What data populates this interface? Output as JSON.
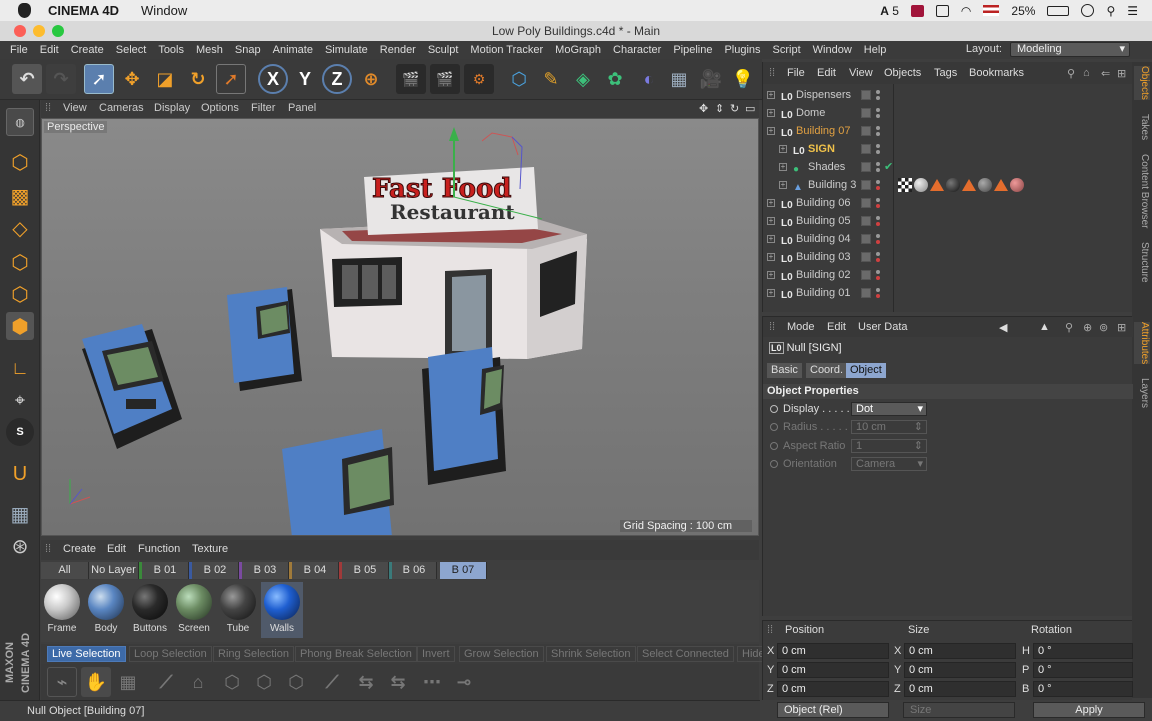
{
  "mac_menubar": {
    "app_name": "CINEMA 4D",
    "menu": "Window",
    "status": {
      "input_number": "5",
      "battery": "25%"
    }
  },
  "window": {
    "title": "Low Poly Buildings.c4d * - Main"
  },
  "main_menu": [
    "File",
    "Edit",
    "Create",
    "Select",
    "Tools",
    "Mesh",
    "Snap",
    "Animate",
    "Simulate",
    "Render",
    "Sculpt",
    "Motion Tracker",
    "MoGraph",
    "Character",
    "Pipeline",
    "Plugins",
    "Script",
    "Window",
    "Help"
  ],
  "layout": {
    "label": "Layout:",
    "value": "Modeling"
  },
  "toolbar": {
    "axis_x": "X",
    "axis_y": "Y",
    "axis_z": "Z"
  },
  "viewport": {
    "menu": [
      "View",
      "Cameras",
      "Display",
      "Options",
      "Filter",
      "Panel"
    ],
    "camera_label": "Perspective",
    "grid_spacing": "Grid Spacing : 100 cm",
    "sign_line1": "Fast Food",
    "sign_line2": "Restaurant"
  },
  "material_manager": {
    "menu": [
      "Create",
      "Edit",
      "Function",
      "Texture"
    ],
    "layers": [
      "All",
      "No Layer",
      "B 01",
      "B 02",
      "B 03",
      "B 04",
      "B 05",
      "B 06",
      "B 07"
    ],
    "active_layer": "B 07",
    "materials": [
      {
        "name": "Frame",
        "color": "#c9c9c9"
      },
      {
        "name": "Body",
        "color": "#5a86c2"
      },
      {
        "name": "Buttons",
        "color": "#2a2a2a"
      },
      {
        "name": "Screen",
        "color": "#6c8c63"
      },
      {
        "name": "Tube",
        "color": "#444444"
      },
      {
        "name": "Walls",
        "color": "#1f5fd1"
      }
    ]
  },
  "selection_bar": [
    "Live Selection",
    "Loop Selection",
    "Ring Selection",
    "Phong Break Selection",
    "Invert",
    "Grow Selection",
    "Shrink Selection",
    "Select Connected",
    "Hide"
  ],
  "status_bar": "Null Object [Building 07]",
  "maxon_logo": "MAXON CINEMA 4D",
  "object_manager": {
    "menu": [
      "File",
      "Edit",
      "View",
      "Objects",
      "Tags",
      "Bookmarks"
    ],
    "objects": [
      {
        "name": "Dispensers",
        "indent": 0,
        "color": "#cccccc"
      },
      {
        "name": "Dome",
        "indent": 0,
        "color": "#cccccc"
      },
      {
        "name": "Building 07",
        "indent": 0,
        "color": "#e2a142"
      },
      {
        "name": "SIGN",
        "indent": 1,
        "color": "#f0c24a"
      },
      {
        "name": "Shades",
        "indent": 1,
        "color": "#cccccc"
      },
      {
        "name": "Building 3",
        "indent": 1,
        "color": "#cccccc"
      },
      {
        "name": "Building 06",
        "indent": 0,
        "color": "#cccccc"
      },
      {
        "name": "Building 05",
        "indent": 0,
        "color": "#cccccc"
      },
      {
        "name": "Building 04",
        "indent": 0,
        "color": "#cccccc"
      },
      {
        "name": "Building 03",
        "indent": 0,
        "color": "#cccccc"
      },
      {
        "name": "Building 02",
        "indent": 0,
        "color": "#cccccc"
      },
      {
        "name": "Building 01",
        "indent": 0,
        "color": "#cccccc"
      }
    ]
  },
  "right_tabs": [
    "Objects",
    "Takes",
    "Content Browser",
    "Structure",
    "Attributes",
    "Layers"
  ],
  "attributes": {
    "menu": [
      "Mode",
      "Edit",
      "User Data"
    ],
    "object_title": "Null [SIGN]",
    "tabs": [
      "Basic",
      "Coord.",
      "Object"
    ],
    "active_tab": "Object",
    "section": "Object Properties",
    "props": [
      {
        "label": "Display . . . . .",
        "value": "Dot",
        "enabled": true
      },
      {
        "label": "Radius . . . . .",
        "value": "10 cm",
        "enabled": false
      },
      {
        "label": "Aspect Ratio",
        "value": "1",
        "enabled": false
      },
      {
        "label": "Orientation",
        "value": "Camera",
        "enabled": false
      }
    ]
  },
  "coordinates": {
    "headers": [
      "Position",
      "Size",
      "Rotation"
    ],
    "rows": [
      {
        "pa": "X",
        "pv": "0 cm",
        "sa": "X",
        "sv": "0 cm",
        "ra": "H",
        "rv": "0 °"
      },
      {
        "pa": "Y",
        "pv": "0 cm",
        "sa": "Y",
        "sv": "0 cm",
        "ra": "P",
        "rv": "0 °"
      },
      {
        "pa": "Z",
        "pv": "0 cm",
        "sa": "Z",
        "sv": "0 cm",
        "ra": "B",
        "rv": "0 °"
      }
    ],
    "mode": "Object (Rel)",
    "size_mode": "Size",
    "apply": "Apply"
  }
}
